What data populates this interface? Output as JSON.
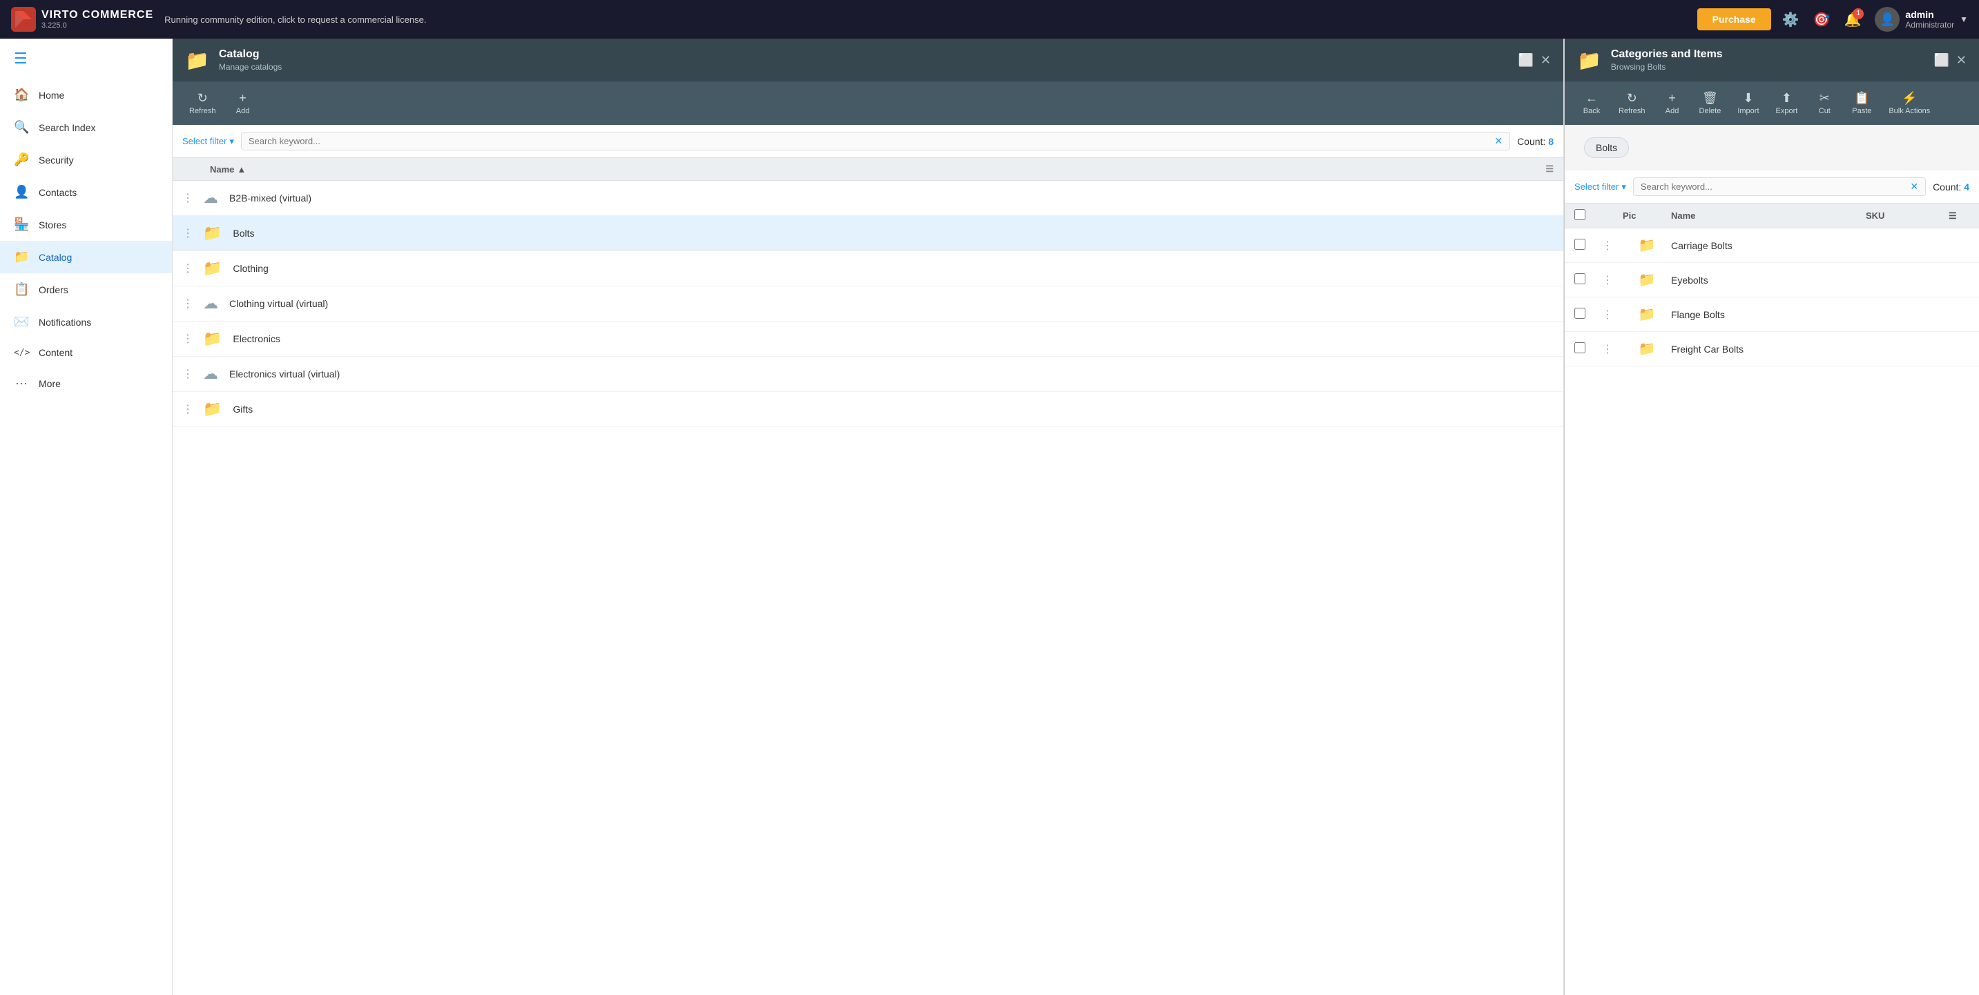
{
  "app": {
    "name": "VIRTO COMMERCE",
    "version": "3.225.0",
    "notice": "Running community edition, click to request a commercial license.",
    "purchase_label": "Purchase"
  },
  "topbar": {
    "icons": [
      "settings",
      "help",
      "notifications"
    ],
    "notification_count": "1",
    "user": {
      "name": "admin",
      "role": "Administrator"
    }
  },
  "sidebar": {
    "items": [
      {
        "icon": "🏠",
        "label": "Home",
        "active": false
      },
      {
        "icon": "🔍",
        "label": "Search Index",
        "active": false
      },
      {
        "icon": "🔑",
        "label": "Security",
        "active": false
      },
      {
        "icon": "👤",
        "label": "Contacts",
        "active": false
      },
      {
        "icon": "🏪",
        "label": "Stores",
        "active": false
      },
      {
        "icon": "📁",
        "label": "Catalog",
        "active": true
      },
      {
        "icon": "📋",
        "label": "Orders",
        "active": false
      },
      {
        "icon": "✉️",
        "label": "Notifications",
        "active": false
      },
      {
        "icon": "</>",
        "label": "Content",
        "active": false
      },
      {
        "icon": "···",
        "label": "More",
        "active": false
      }
    ]
  },
  "left_panel": {
    "title": "Catalog",
    "subtitle": "Manage catalogs",
    "toolbar": {
      "refresh_label": "Refresh",
      "add_label": "Add"
    },
    "filter_placeholder": "Search keyword...",
    "count_label": "Count:",
    "count_value": "8",
    "column_name": "Name",
    "items": [
      {
        "name": "B2B-mixed (virtual)",
        "virtual": true,
        "selected": false
      },
      {
        "name": "Bolts",
        "virtual": false,
        "selected": true
      },
      {
        "name": "Clothing",
        "virtual": false,
        "selected": false
      },
      {
        "name": "Clothing virtual (virtual)",
        "virtual": true,
        "selected": false
      },
      {
        "name": "Electronics",
        "virtual": false,
        "selected": false
      },
      {
        "name": "Electronics virtual (virtual)",
        "virtual": true,
        "selected": false
      },
      {
        "name": "Gifts",
        "virtual": false,
        "selected": false
      }
    ]
  },
  "right_panel": {
    "title": "Categories and Items",
    "subtitle": "Browsing Bolts",
    "breadcrumb": "Bolts",
    "toolbar": {
      "back_label": "Back",
      "refresh_label": "Refresh",
      "add_label": "Add",
      "delete_label": "Delete",
      "import_label": "Import",
      "export_label": "Export",
      "cut_label": "Cut",
      "paste_label": "Paste",
      "bulk_actions_label": "Bulk Actions"
    },
    "filter_placeholder": "Search keyword...",
    "count_label": "Count:",
    "count_value": "4",
    "columns": {
      "pic": "Pic",
      "name": "Name",
      "sku": "SKU"
    },
    "items": [
      {
        "name": "Carriage Bolts",
        "sku": ""
      },
      {
        "name": "Eyebolts",
        "sku": ""
      },
      {
        "name": "Flange Bolts",
        "sku": ""
      },
      {
        "name": "Freight Car Bolts",
        "sku": ""
      }
    ]
  }
}
